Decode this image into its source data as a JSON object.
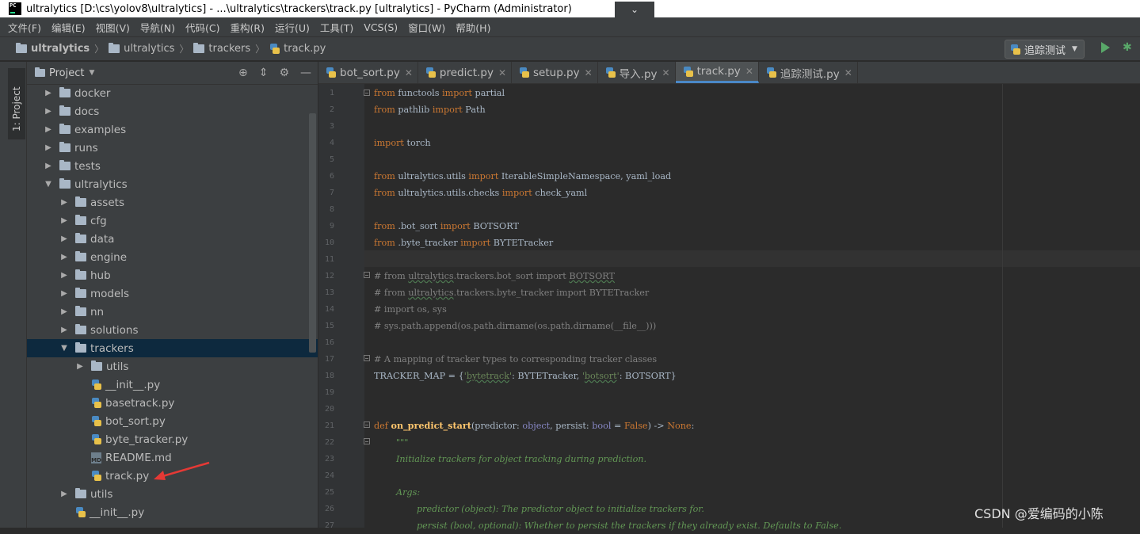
{
  "window": {
    "title": "ultralytics [D:\\cs\\yolov8\\ultralytics] - ...\\ultralytics\\trackers\\track.py [ultralytics] - PyCharm (Administrator)",
    "logo_text": "PC"
  },
  "menu": [
    "文件(F)",
    "编辑(E)",
    "视图(V)",
    "导航(N)",
    "代码(C)",
    "重构(R)",
    "运行(U)",
    "工具(T)",
    "VCS(S)",
    "窗口(W)",
    "帮助(H)"
  ],
  "breadcrumb": [
    "ultralytics",
    "ultralytics",
    "trackers",
    "track.py"
  ],
  "run_config": {
    "label": "追踪测试"
  },
  "side_stripe": {
    "label": "1: Project"
  },
  "project_panel": {
    "title": "Project",
    "tree": [
      {
        "label": "docker",
        "type": "folder",
        "expanded": false
      },
      {
        "label": "docs",
        "type": "folder",
        "expanded": false
      },
      {
        "label": "examples",
        "type": "folder",
        "expanded": false
      },
      {
        "label": "runs",
        "type": "folder",
        "expanded": false
      },
      {
        "label": "tests",
        "type": "folder",
        "expanded": false
      },
      {
        "label": "ultralytics",
        "type": "folder",
        "expanded": true
      },
      {
        "label": "assets",
        "type": "folder",
        "expanded": false
      },
      {
        "label": "cfg",
        "type": "folder",
        "expanded": false
      },
      {
        "label": "data",
        "type": "folder",
        "expanded": false
      },
      {
        "label": "engine",
        "type": "folder",
        "expanded": false
      },
      {
        "label": "hub",
        "type": "folder",
        "expanded": false
      },
      {
        "label": "models",
        "type": "folder",
        "expanded": false
      },
      {
        "label": "nn",
        "type": "folder",
        "expanded": false
      },
      {
        "label": "solutions",
        "type": "folder",
        "expanded": false
      },
      {
        "label": "trackers",
        "type": "folder",
        "expanded": true,
        "selected": true
      },
      {
        "label": "utils",
        "type": "folder",
        "expanded": false
      },
      {
        "label": "__init__.py",
        "type": "python"
      },
      {
        "label": "basetrack.py",
        "type": "python"
      },
      {
        "label": "bot_sort.py",
        "type": "python"
      },
      {
        "label": "byte_tracker.py",
        "type": "python"
      },
      {
        "label": "README.md",
        "type": "markdown"
      },
      {
        "label": "track.py",
        "type": "python"
      },
      {
        "label": "utils",
        "type": "folder",
        "expanded": false
      },
      {
        "label": "__init__.py",
        "type": "python"
      }
    ]
  },
  "tabs": [
    {
      "label": "bot_sort.py",
      "active": false
    },
    {
      "label": "predict.py",
      "active": false
    },
    {
      "label": "setup.py",
      "active": false
    },
    {
      "label": "导入.py",
      "active": false
    },
    {
      "label": "track.py",
      "active": true
    },
    {
      "label": "追踪测试.py",
      "active": false
    }
  ],
  "line_numbers": [
    "1",
    "2",
    "3",
    "4",
    "5",
    "6",
    "7",
    "8",
    "9",
    "10",
    "11",
    "12",
    "13",
    "14",
    "15",
    "16",
    "17",
    "18",
    "19",
    "20",
    "21",
    "22",
    "23",
    "24",
    "25",
    "26",
    "27"
  ],
  "code": {
    "l1": [
      "from",
      " functools ",
      "import",
      " partial"
    ],
    "l2": [
      "from",
      " pathlib ",
      "import",
      " Path"
    ],
    "l4": [
      "import",
      " torch"
    ],
    "l6": [
      "from",
      " ultralytics.utils ",
      "import",
      " IterableSimpleNamespace, yaml_load"
    ],
    "l7": [
      "from",
      " ultralytics.utils.checks ",
      "import",
      " check_yaml"
    ],
    "l9": [
      "from",
      " .bot_sort ",
      "import",
      " BOTSORT"
    ],
    "l10": [
      "from",
      " .byte_tracker ",
      "import",
      " BYTETracker"
    ],
    "l12": [
      "# from ",
      "ultralytics",
      ".trackers.bot_sort import ",
      "BOTSORT"
    ],
    "l13": [
      "# from ",
      "ultralytics",
      ".trackers.byte_tracker import BYTETracker"
    ],
    "l14": "# import os, sys",
    "l15": "# sys.path.append(os.path.dirname(os.path.dirname(__file__)))",
    "l17": "# A mapping of tracker types to corresponding tracker classes",
    "l18": [
      "TRACKER_MAP = {",
      "'",
      "bytetrack",
      "'",
      ": BYTETracker, ",
      "'",
      "botsort",
      "'",
      ": BOTSORT}"
    ],
    "l21": [
      "def ",
      "on_predict_start",
      "(predictor: ",
      "object",
      ", persist: ",
      "bool",
      " = ",
      "False",
      ") -> ",
      "None",
      ":"
    ],
    "l22": "\"\"\"",
    "l23": "Initialize trackers for object tracking during prediction.",
    "l25": "Args:",
    "l26": "predictor (object): The predictor object to initialize trackers for.",
    "l27": "persist (bool, optional): Whether to persist the trackers if they already exist. Defaults to False."
  },
  "watermark": "CSDN @爱编码的小陈",
  "colors": {
    "accent": "#4a88c7",
    "selection": "#0d293e",
    "annotation_arrow": "#e53935"
  }
}
